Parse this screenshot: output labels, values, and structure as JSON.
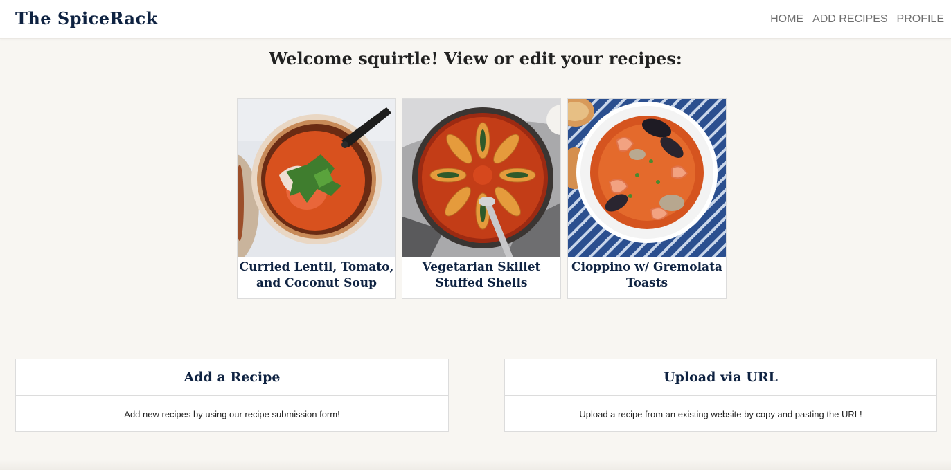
{
  "navbar": {
    "brand": "The SpiceRack",
    "links": [
      "HOME",
      "ADD RECIPES",
      "PROFILE"
    ]
  },
  "welcome": "Welcome squirtle! View or edit your recipes:",
  "recipes": [
    {
      "title": "Curried Lentil, Tomato, and Coconut Soup",
      "image": "lentil-soup-photo"
    },
    {
      "title": "Vegetarian Skillet Stuffed Shells",
      "image": "stuffed-shells-photo"
    },
    {
      "title": "Cioppino w/ Gremolata Toasts",
      "image": "cioppino-photo"
    }
  ],
  "actions": [
    {
      "title": "Add a Recipe",
      "description": "Add new recipes by using our recipe submission form!"
    },
    {
      "title": "Upload via URL",
      "description": "Upload a recipe from an existing website by copy and pasting the URL!"
    }
  ],
  "colors": {
    "brand": "#0e2241",
    "background": "#f8f6f2",
    "nav_link": "#6f6f6f"
  }
}
